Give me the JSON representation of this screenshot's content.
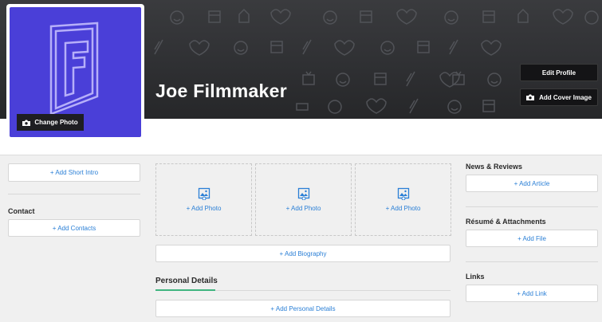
{
  "profile": {
    "name": "Joe Filmmaker",
    "change_photo_label": "Change Photo",
    "edit_profile_label": "Edit Profile",
    "add_cover_image_label": "Add Cover Image",
    "avatar_color": "#4a3fd8"
  },
  "left_column": {
    "add_short_intro_label": "+ Add Short Intro",
    "contact_title": "Contact",
    "add_contacts_label": "+ Add Contacts"
  },
  "middle_column": {
    "photos": [
      {
        "label": "+ Add Photo"
      },
      {
        "label": "+ Add Photo"
      },
      {
        "label": "+ Add Photo"
      }
    ],
    "add_biography_label": "+ Add Biography",
    "personal_details_title": "Personal Details",
    "add_personal_details_label": "+ Add Personal Details"
  },
  "right_column": {
    "news_title": "News & Reviews",
    "add_article_label": "+ Add Article",
    "resume_title": "Résumé & Attachments",
    "add_file_label": "+ Add File",
    "links_title": "Links",
    "add_link_label": "+ Add Link"
  },
  "icons": {
    "camera": "camera-icon",
    "photo": "photo-placeholder-icon",
    "logo": "f-logo-icon"
  },
  "colors": {
    "link_blue": "#2a7fd6",
    "accent_green": "#3fb47f",
    "cover_dark": "#2f3033"
  }
}
